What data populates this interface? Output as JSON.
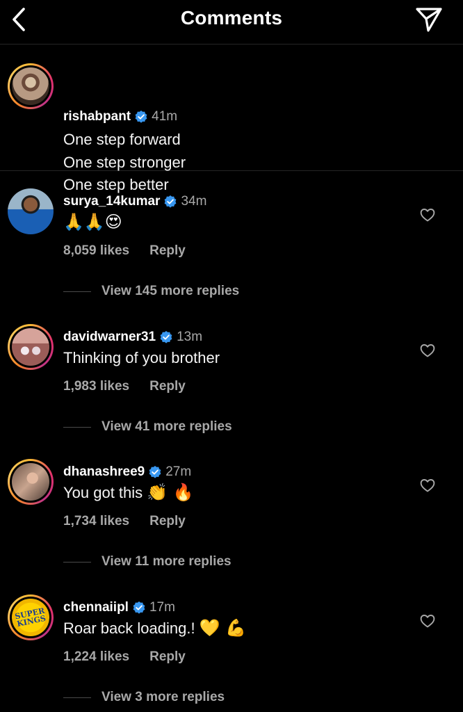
{
  "header": {
    "title": "Comments",
    "back_icon": "chevron-left-icon",
    "share_icon": "paper-plane-icon"
  },
  "colors": {
    "background": "#000000",
    "verified": "#3897f0",
    "secondary_text": "#a8a8a8",
    "divider": "#262626"
  },
  "caption": {
    "username": "rishabpant",
    "time": "41m",
    "lines": [
      "One step forward",
      "One step stronger",
      "One step better"
    ]
  },
  "comments": [
    {
      "username": "surya_14kumar",
      "time": "34m",
      "text": "",
      "emojis": "🙏🙏😍",
      "likes": "8,059 likes",
      "reply_label": "Reply",
      "view_replies": "View 145 more replies"
    },
    {
      "username": "davidwarner31",
      "time": "13m",
      "text": "Thinking of you brother",
      "emojis": "",
      "likes": "1,983 likes",
      "reply_label": "Reply",
      "view_replies": "View 41 more replies"
    },
    {
      "username": "dhanashree9",
      "time": "27m",
      "text": "You got this ",
      "emojis": "👏 🔥",
      "likes": "1,734 likes",
      "reply_label": "Reply",
      "view_replies": "View 11 more replies"
    },
    {
      "username": "chennaiipl",
      "time": "17m",
      "text": "Roar back loading.! ",
      "emojis": "💛 💪",
      "likes": "1,224 likes",
      "reply_label": "Reply",
      "view_replies": "View 3 more replies"
    }
  ],
  "avatar_logo": {
    "chennaiipl": "SUPER KINGS"
  }
}
